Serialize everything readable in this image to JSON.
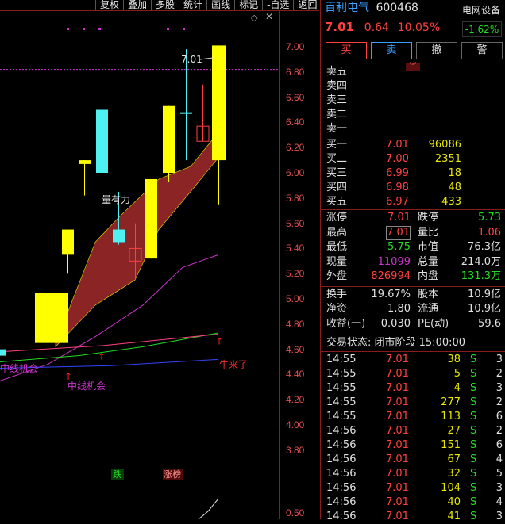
{
  "toolbar": [
    "复权",
    "叠加",
    "多股",
    "统计",
    "画线",
    "标记",
    "-自选",
    "返回"
  ],
  "chart": {
    "price_labels": [
      "7.00",
      "6.80",
      "6.60",
      "6.40",
      "6.20",
      "6.00",
      "5.80",
      "5.60",
      "5.40",
      "5.20",
      "5.00",
      "4.80",
      "4.60",
      "4.40",
      "4.20",
      "4.00",
      "3.80"
    ],
    "indicator_label": "0.50",
    "annotation_high": "7.01",
    "annotation_volume": "量有力",
    "annotation_midline": "中线机会",
    "annotation_midline_left": "中线机会",
    "annotation_bull": "牛来了",
    "tag_fall": "跌",
    "tag_limit": "涨榜",
    "colors": {
      "up": "#ffff00",
      "down": "#4ff0f0",
      "band": "#8b2525",
      "axis": "#8b1a1a"
    }
  },
  "stock": {
    "name": "百利电气",
    "code": "600468",
    "price": "7.01",
    "change": "0.64",
    "change_pct": "10.05%",
    "sector": "电网设备",
    "sector_pct": "-1.62%"
  },
  "buttons": {
    "buy": "买",
    "sell": "卖",
    "cancel": "撤",
    "alert": "警"
  },
  "sell_levels": [
    "卖五",
    "卖四",
    "卖三",
    "卖二",
    "卖一"
  ],
  "buy_levels": [
    {
      "label": "买一",
      "price": "7.01",
      "vol": "96086"
    },
    {
      "label": "买二",
      "price": "7.00",
      "vol": "2351"
    },
    {
      "label": "买三",
      "price": "6.99",
      "vol": "18"
    },
    {
      "label": "买四",
      "price": "6.98",
      "vol": "48"
    },
    {
      "label": "买五",
      "price": "6.97",
      "vol": "433"
    }
  ],
  "stats": {
    "limit_up_lbl": "涨停",
    "limit_up": "7.01",
    "limit_down_lbl": "跌停",
    "limit_down": "5.73",
    "high_lbl": "最高",
    "high": "7.01",
    "vol_ratio_lbl": "量比",
    "vol_ratio": "1.06",
    "low_lbl": "最低",
    "low": "5.75",
    "mkt_cap_lbl": "市值",
    "mkt_cap": "76.3亿",
    "cur_vol_lbl": "现量",
    "cur_vol": "11099",
    "total_vol_lbl": "总量",
    "total_vol": "214.0万",
    "outer_lbl": "外盘",
    "outer": "826994",
    "inner_lbl": "内盘",
    "inner": "131.3万",
    "turnover_lbl": "换手",
    "turnover": "19.67%",
    "equity_lbl": "股本",
    "equity": "10.9亿",
    "net_assets_lbl": "净资",
    "net_assets": "1.80",
    "float_lbl": "流通",
    "float": "10.9亿",
    "eps_lbl": "收益(一)",
    "eps": "0.030",
    "pe_lbl": "PE(动)",
    "pe": "59.6"
  },
  "status": "交易状态: 闭市阶段 15:00:00",
  "ticks": [
    {
      "t": "14:55",
      "p": "7.01",
      "v": "38",
      "s": "S",
      "n": "3"
    },
    {
      "t": "14:55",
      "p": "7.01",
      "v": "5",
      "s": "S",
      "n": "2"
    },
    {
      "t": "14:55",
      "p": "7.01",
      "v": "4",
      "s": "S",
      "n": "3"
    },
    {
      "t": "14:55",
      "p": "7.01",
      "v": "277",
      "s": "S",
      "n": "2"
    },
    {
      "t": "14:55",
      "p": "7.01",
      "v": "113",
      "s": "S",
      "n": "6"
    },
    {
      "t": "14:56",
      "p": "7.01",
      "v": "27",
      "s": "S",
      "n": "2"
    },
    {
      "t": "14:56",
      "p": "7.01",
      "v": "151",
      "s": "S",
      "n": "6"
    },
    {
      "t": "14:56",
      "p": "7.01",
      "v": "67",
      "s": "S",
      "n": "4"
    },
    {
      "t": "14:56",
      "p": "7.01",
      "v": "32",
      "s": "S",
      "n": "5"
    },
    {
      "t": "14:56",
      "p": "7.01",
      "v": "104",
      "s": "S",
      "n": "3"
    },
    {
      "t": "14:56",
      "p": "7.01",
      "v": "40",
      "s": "S",
      "n": "4"
    },
    {
      "t": "14:56",
      "p": "7.01",
      "v": "41",
      "s": "S",
      "n": "3"
    }
  ]
}
